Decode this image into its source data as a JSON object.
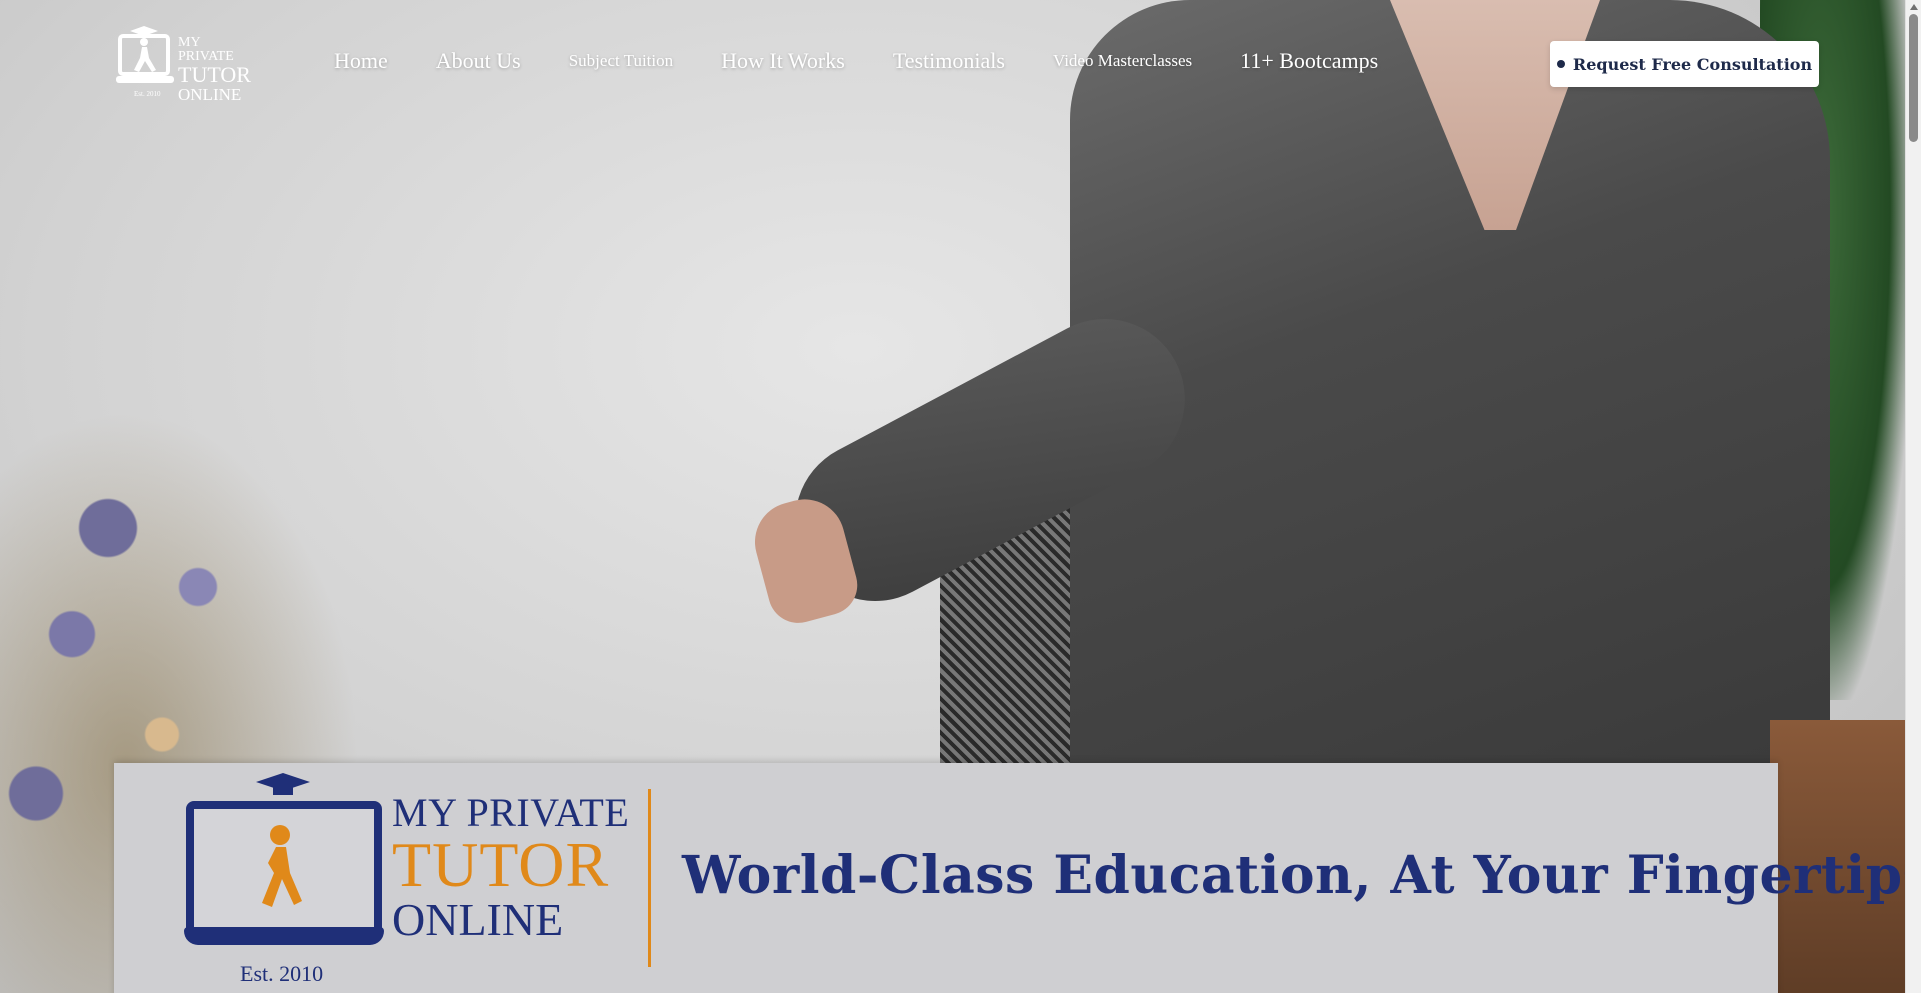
{
  "header": {
    "logo": {
      "line1": "MY PRIVATE",
      "line2": "TUTOR",
      "line3": "ONLINE",
      "est": "Est. 2010"
    },
    "nav": [
      {
        "label": "Home"
      },
      {
        "label": "About Us"
      },
      {
        "label": "Subject Tuition"
      },
      {
        "label": "How It Works"
      },
      {
        "label": "Testimonials"
      },
      {
        "label": "Video Masterclasses"
      },
      {
        "label": "11+ Bootcamps"
      }
    ],
    "cta": {
      "label": "Request Free Consultation"
    }
  },
  "hero": {
    "banner": {
      "brand_line1": "MY PRIVATE",
      "brand_line2": "TUTOR",
      "brand_line3": "ONLINE",
      "est": "Est. 2010",
      "tagline": "World-Class Education, At Your Fingertips"
    }
  },
  "colors": {
    "brand_navy": "#1f2f78",
    "brand_orange": "#e0891a",
    "cta_text": "#1e2a4a"
  }
}
